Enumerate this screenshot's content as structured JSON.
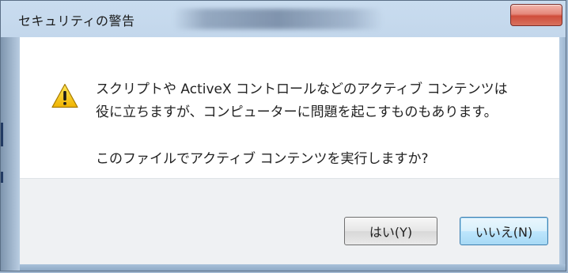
{
  "window": {
    "title": "セキュリティの警告"
  },
  "dialog": {
    "icon": "warning-icon",
    "message_line1": "スクリプトや ActiveX コントロールなどのアクティブ コンテンツは",
    "message_line2": "役に立ちますが、コンピューターに問題を起こすものもあります。",
    "question": "このファイルでアクティブ コンテンツを実行しますか?"
  },
  "buttons": {
    "yes_label": "はい(Y)",
    "no_label": "いいえ(N)"
  },
  "colors": {
    "warning_yellow": "#f5c400",
    "close_red": "#cf4d3b",
    "default_button_blue": "#3c7fb1"
  }
}
